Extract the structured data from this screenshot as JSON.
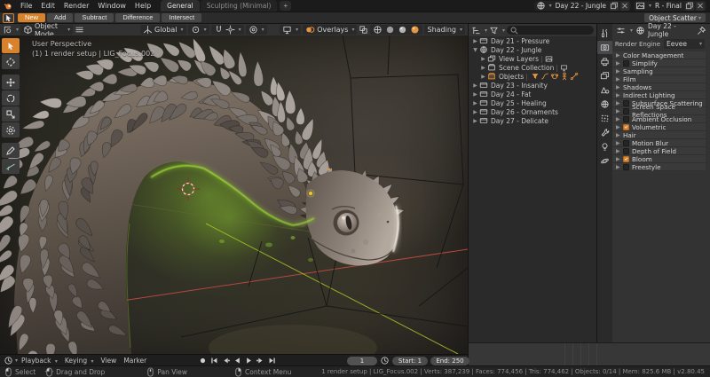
{
  "topbar": {
    "menus": [
      "File",
      "Edit",
      "Render",
      "Window",
      "Help"
    ],
    "workspace_tabs": [
      {
        "label": "General",
        "active": true
      },
      {
        "label": "Sculpting (Minimal)",
        "active": false
      }
    ],
    "new_workspace_button": "+",
    "scene": {
      "value": "Day 22 - Jungle"
    },
    "view_layer": {
      "value": "R - Final"
    }
  },
  "tool_settings": {
    "brush_buttons": [
      {
        "label": "New",
        "active": true
      },
      {
        "label": "Add",
        "active": false
      },
      {
        "label": "Subtract",
        "active": false
      },
      {
        "label": "Difference",
        "active": false
      },
      {
        "label": "Intersect",
        "active": false
      }
    ],
    "right_dropdown": "Object Scatter"
  },
  "viewport_header": {
    "mode": "Object Mode",
    "orientation": "Global",
    "overlays_label": "Overlays",
    "shading_label": "Shading"
  },
  "viewport": {
    "overlay_line1": "User Perspective",
    "overlay_line2": "(1) 1 render setup | LIG_Focus.002",
    "tools": [
      "select-box",
      "cursor",
      "move",
      "rotate",
      "scale",
      "transform",
      "annotate",
      "measure"
    ]
  },
  "outliner": {
    "search_placeholder": "",
    "items": [
      {
        "label": "Day 21 - Pressure",
        "depth": 0,
        "icon": "scene",
        "caret": "right"
      },
      {
        "label": "Day 22 - Jungle",
        "depth": 0,
        "icon": "scene-world",
        "caret": "down"
      },
      {
        "label": "View Layers",
        "depth": 1,
        "icon": "viewlayers",
        "caret": "right",
        "badge": "photo"
      },
      {
        "label": "Scene Collection",
        "depth": 1,
        "icon": "collection",
        "caret": "right",
        "badge": "screen"
      },
      {
        "label": "Objects",
        "depth": 1,
        "icon": "collection-orange",
        "caret": "right",
        "objects": [
          "mesh",
          "curve",
          "monkey",
          "armature",
          "bone"
        ]
      },
      {
        "label": "Day 23 - Insanity",
        "depth": 0,
        "icon": "scene",
        "caret": "right"
      },
      {
        "label": "Day 24 - Fat",
        "depth": 0,
        "icon": "scene",
        "caret": "right"
      },
      {
        "label": "Day 25 - Healing",
        "depth": 0,
        "icon": "scene",
        "caret": "right"
      },
      {
        "label": "Day 26 - Ornaments",
        "depth": 0,
        "icon": "scene",
        "caret": "right"
      },
      {
        "label": "Day 27 - Delicate",
        "depth": 0,
        "icon": "scene",
        "caret": "right"
      }
    ]
  },
  "properties": {
    "breadcrumb": "Day 22 - Jungle",
    "render_engine_label": "Render Engine",
    "render_engine": "Eevee",
    "tabs": [
      "tool",
      "render",
      "output",
      "view-layer",
      "scene",
      "world",
      "object",
      "modifiers",
      "light-data",
      "physics"
    ],
    "active_tab": "render",
    "panels": [
      {
        "label": "Color Management"
      },
      {
        "label": "Simplify",
        "checkbox": false
      },
      {
        "label": "Sampling"
      },
      {
        "label": "Film"
      },
      {
        "label": "Shadows"
      },
      {
        "label": "Indirect Lighting"
      },
      {
        "label": "Subsurface Scattering",
        "checkbox": false
      },
      {
        "label": "Screen Space Reflections",
        "checkbox": false
      },
      {
        "label": "Ambient Occlusion",
        "checkbox": false
      },
      {
        "label": "Volumetric",
        "checkbox": true
      },
      {
        "label": "Hair"
      },
      {
        "label": "Motion Blur",
        "checkbox": false
      },
      {
        "label": "Depth of Field",
        "checkbox": false
      },
      {
        "label": "Bloom",
        "checkbox": true
      },
      {
        "label": "Freestyle",
        "checkbox": false
      }
    ]
  },
  "timeline": {
    "menus": [
      {
        "label": "Playback",
        "dropdown": true
      },
      {
        "label": "Keying",
        "dropdown": true
      },
      {
        "label": "View",
        "dropdown": false
      },
      {
        "label": "Marker",
        "dropdown": false
      }
    ],
    "current_frame": "1",
    "start_field": "Start:  1",
    "end_field": "End:  250"
  },
  "status_bar": {
    "hints": [
      {
        "label": "Select",
        "icon": "m-left"
      },
      {
        "label": "Drag and Drop",
        "icon": "m-drag"
      },
      {
        "label": "Pan View",
        "icon": "m-mid"
      },
      {
        "label": "Context Menu",
        "icon": "m-right"
      }
    ],
    "stats": "1 render setup | LIG_Focus.002 | Verts: 387,239 | Faces: 774,456 | Tris: 774,462 | Objects: 0/14 | Mem: 825.6 MB | v2.80.45"
  },
  "colors": {
    "accent": "#d9822c",
    "glow_green": "#8fd42a",
    "axis_red": "#c24b42",
    "axis_green": "#a4c428"
  }
}
